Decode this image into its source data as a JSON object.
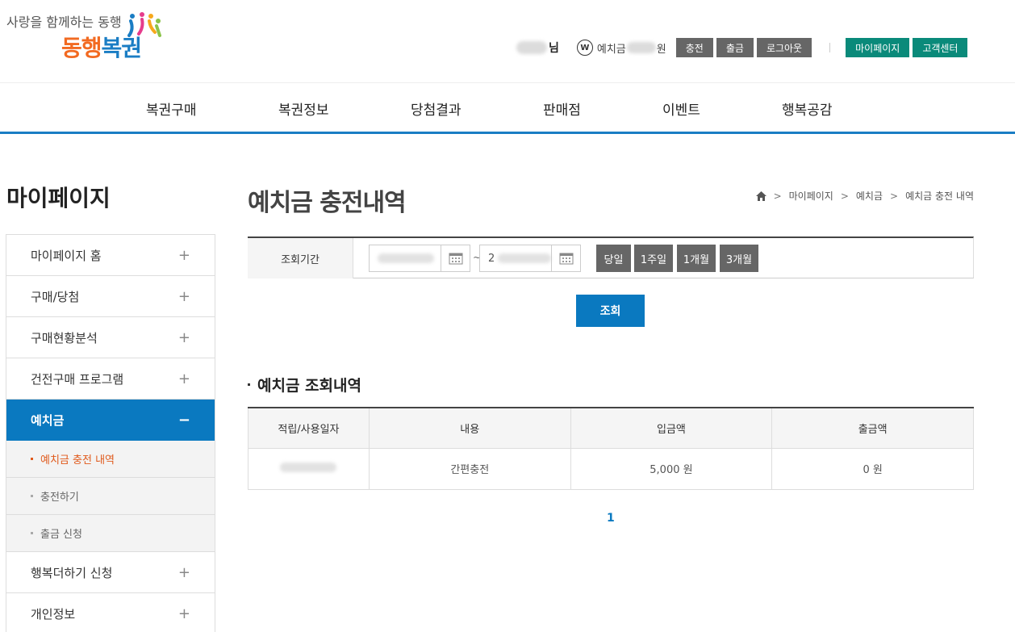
{
  "header": {
    "slogan": "사랑을 함께하는 동행",
    "logo_part1": "동행",
    "logo_part2": "복권",
    "user_suffix": "님",
    "won_symbol": "W",
    "deposit_label": "예치금",
    "deposit_unit": "원",
    "buttons": {
      "charge": "충전",
      "withdraw": "출금",
      "logout": "로그아웃",
      "mypage": "마이페이지",
      "support": "고객센터"
    }
  },
  "gnb": [
    "복권구매",
    "복권정보",
    "당첨결과",
    "판매점",
    "이벤트",
    "행복공감"
  ],
  "sidebar": {
    "title": "마이페이지",
    "items": [
      {
        "label": "마이페이지 홈",
        "sign": "+"
      },
      {
        "label": "구매/당첨",
        "sign": "+"
      },
      {
        "label": "구매현황분석",
        "sign": "+"
      },
      {
        "label": "건전구매 프로그램",
        "sign": "+"
      },
      {
        "label": "예치금",
        "sign": "−"
      }
    ],
    "sub_items": [
      "예치금 충전 내역",
      "충전하기",
      "출금 신청"
    ],
    "items_after": [
      {
        "label": "행복더하기 신청",
        "sign": "+"
      },
      {
        "label": "개인정보",
        "sign": "+"
      }
    ]
  },
  "main": {
    "title": "예치금 충전내역",
    "breadcrumb": [
      "마이페이지",
      "예치금",
      "예치금 충전 내역"
    ],
    "search": {
      "label": "조회기간",
      "tilde": "~",
      "end_date_partial": "2",
      "periods": [
        "당일",
        "1주일",
        "1개월",
        "3개월"
      ],
      "submit": "조회"
    },
    "section_title": "예치금 조회내역",
    "table": {
      "headers": [
        "적립/사용일자",
        "내용",
        "입금액",
        "출금액"
      ],
      "rows": [
        {
          "content": "간편충전",
          "deposit": "5,000 원",
          "withdraw": "0 원"
        }
      ]
    },
    "pagination": "1"
  },
  "colors": {
    "brand_blue": "#0a79c0",
    "brand_orange": "#f26a21",
    "teal": "#0a8a7a",
    "active_sub": "#e05a1c"
  }
}
